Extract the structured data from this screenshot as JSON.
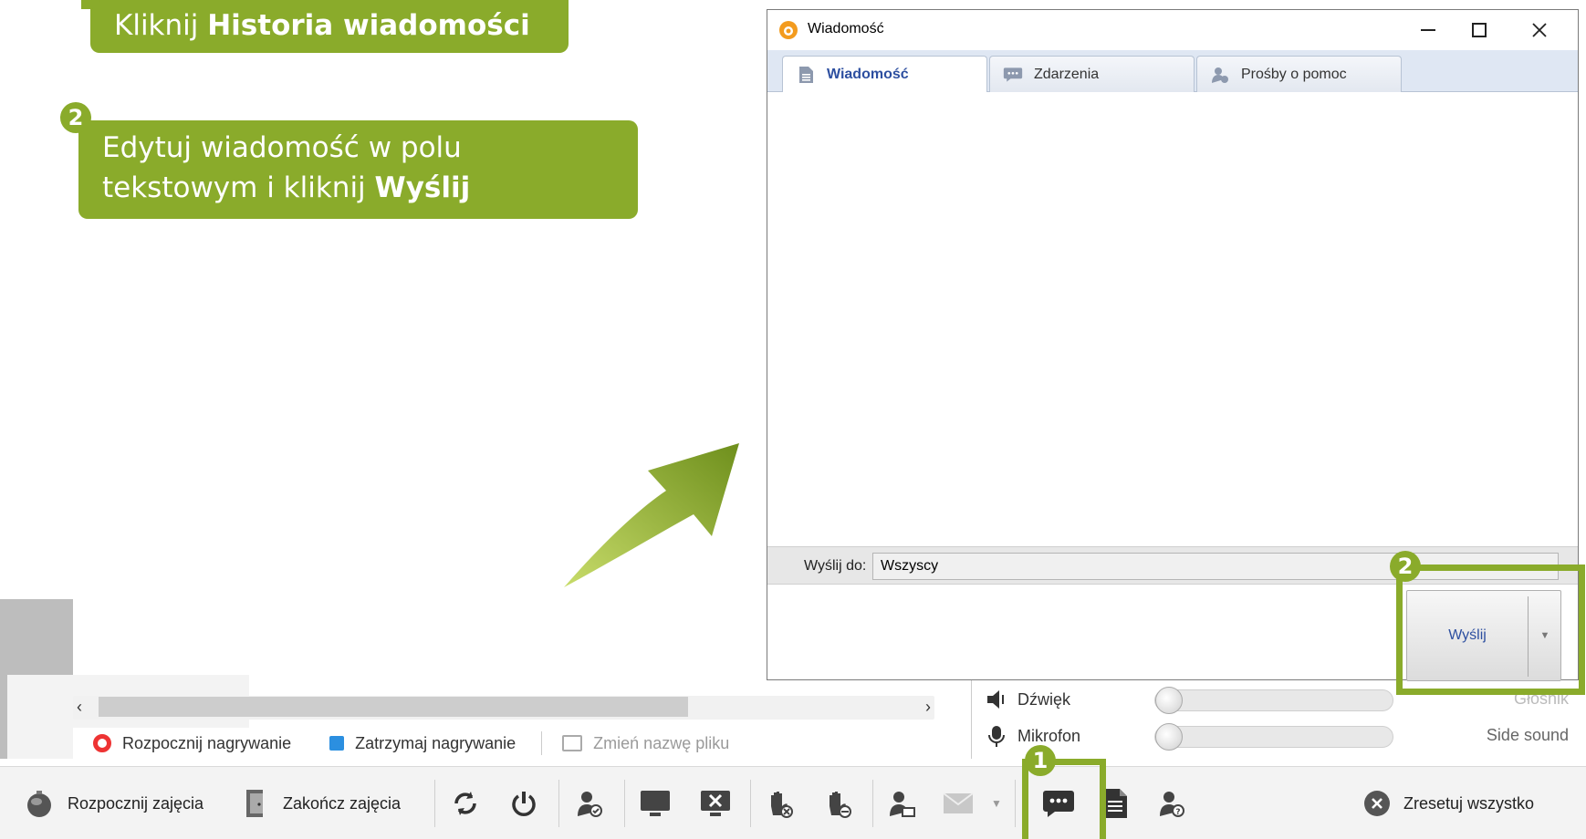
{
  "callouts": [
    {
      "number": "1",
      "text_prefix": "Kliknij ",
      "text_bold": "Historia wiadomości"
    },
    {
      "number": "2",
      "text_line1": "Edytuj wiadomość w polu",
      "text_prefix": "tekstowym i kliknij ",
      "text_bold": "Wyślij"
    }
  ],
  "dialog": {
    "title": "Wiadomość",
    "tabs": [
      {
        "label": "Wiadomość",
        "icon": "document-icon",
        "active": true
      },
      {
        "label": "Zdarzenia",
        "icon": "speech-bubble-icon",
        "active": false
      },
      {
        "label": "Prośby o pomoc",
        "icon": "help-user-icon",
        "active": false
      }
    ],
    "send_to_label": "Wyślij do:",
    "send_to_value": "Wszyscy",
    "send_button": "Wyślij"
  },
  "background_panel": {
    "record_start": "Rozpocznij nagrywanie",
    "record_stop": "Zatrzymaj nagrywanie",
    "rename_file": "Zmień nazwę pliku",
    "sound_label": "Dźwięk",
    "speaker_label": "Głośnik",
    "mic_label": "Mikrofon",
    "side_sound": "Side sound"
  },
  "toolbar": {
    "start_class": "Rozpocznij zajęcia",
    "end_class": "Zakończ zajęcia",
    "reset_all": "Zresetuj wszystko"
  },
  "colors": {
    "accent_green": "#8aab2b",
    "tab_active_text": "#2d4fa0",
    "record_red": "#e33333",
    "stop_blue": "#2b8fe0"
  }
}
